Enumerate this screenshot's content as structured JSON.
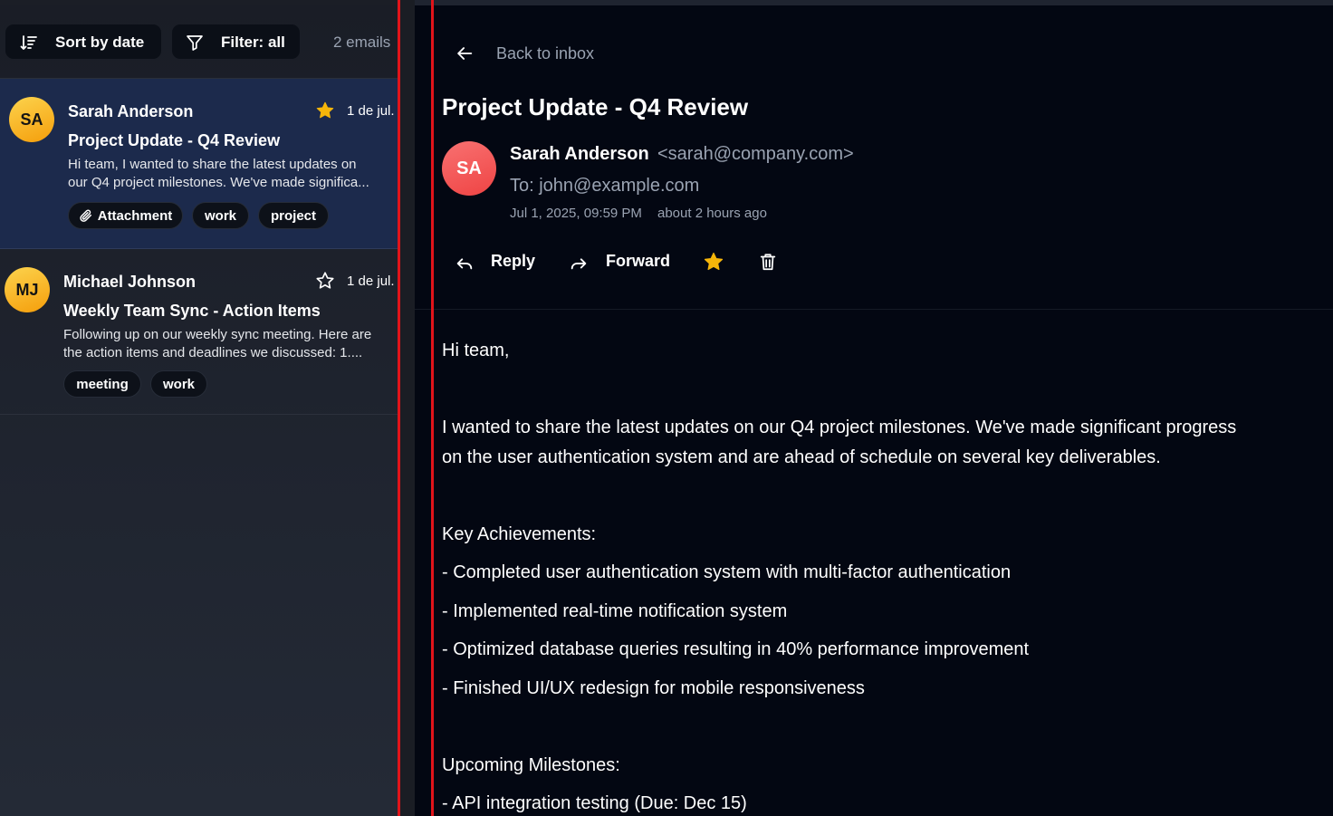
{
  "toolbar": {
    "sort_label": "Sort by date",
    "filter_label": "Filter: all",
    "count": "2 emails"
  },
  "emails": [
    {
      "initials": "SA",
      "sender": "Sarah Anderson",
      "date": "1 de jul.",
      "subject": "Project Update - Q4 Review",
      "preview_line1": "Hi team, I wanted to share the latest updates on",
      "preview_line2": "our Q4 project milestones. We've made significa...",
      "starred": true,
      "tags": [
        "Attachment",
        "work",
        "project"
      ]
    },
    {
      "initials": "MJ",
      "sender": "Michael Johnson",
      "date": "1 de jul.",
      "subject": "Weekly Team Sync - Action Items",
      "preview_line1": "Following up on our weekly sync meeting. Here are",
      "preview_line2": "the action items and deadlines we discussed: 1....",
      "starred": false,
      "tags": [
        "meeting",
        "work"
      ]
    }
  ],
  "detail": {
    "back_label": "Back to inbox",
    "title": "Project Update - Q4 Review",
    "avatar_initials": "SA",
    "from_name": "Sarah Anderson",
    "from_email": "<sarah@company.com>",
    "to": "To: john@example.com",
    "date": "Jul 1, 2025, 09:59 PM",
    "relative": "about 2 hours ago",
    "reply_label": "Reply",
    "forward_label": "Forward",
    "starred": true,
    "body": {
      "greeting": "Hi team,",
      "intro_line1": "I wanted to share the latest updates on our Q4 project milestones. We've made significant progress",
      "intro_line2": "on the user authentication system and are ahead of schedule on several key deliverables.",
      "achievements_heading": "Key Achievements:",
      "achievement_1": "- Completed user authentication system with multi-factor authentication",
      "achievement_2": "- Implemented real-time notification system",
      "achievement_3": "- Optimized database queries resulting in 40% performance improvement",
      "achievement_4": "- Finished UI/UX redesign for mobile responsiveness",
      "milestones_heading": "Upcoming Milestones:",
      "milestone_1": "- API integration testing (Due: Dec 15)"
    }
  },
  "colors": {
    "accent_star": "#f5b50a",
    "selection_bg": "#1c2a4c",
    "highlight_border": "#e1141a",
    "avatar_yellow": "#fbbf24",
    "avatar_red": "#ef4444"
  },
  "icons": [
    "sort-icon",
    "filter-icon",
    "star-icon",
    "paperclip-icon",
    "arrow-left-icon",
    "reply-icon",
    "forward-icon",
    "trash-icon"
  ]
}
